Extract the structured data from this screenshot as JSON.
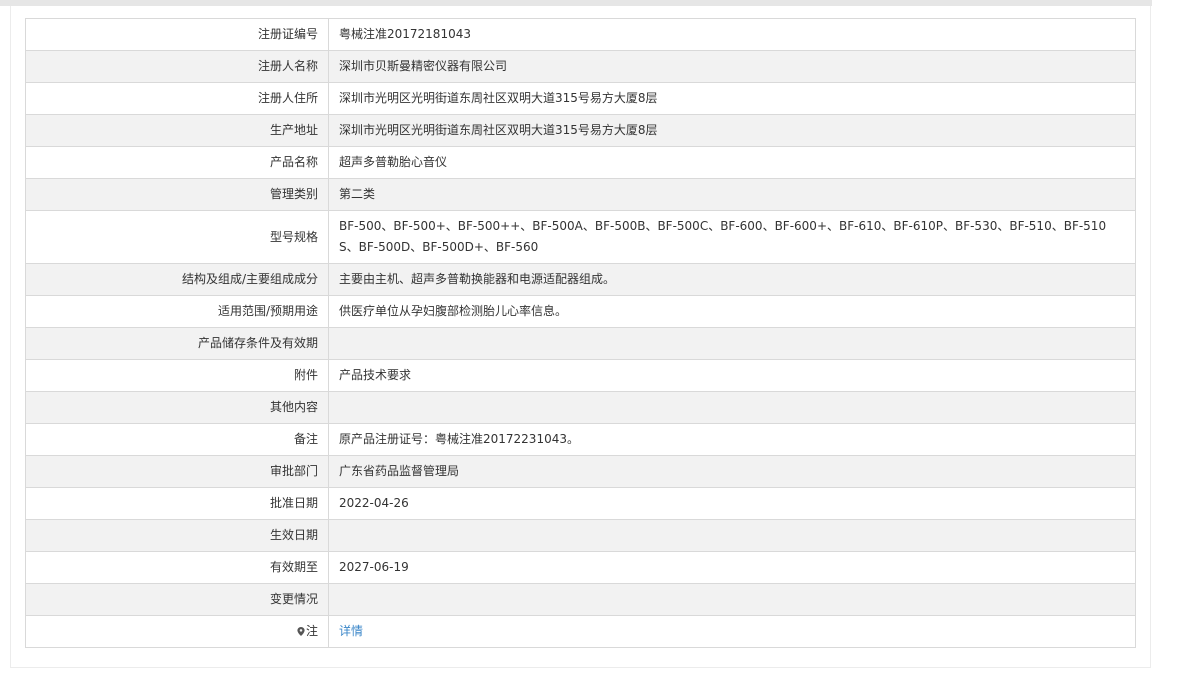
{
  "rows": [
    {
      "label": "注册证编号",
      "value": "粤械注准20172181043"
    },
    {
      "label": "注册人名称",
      "value": "深圳市贝斯曼精密仪器有限公司"
    },
    {
      "label": "注册人住所",
      "value": "深圳市光明区光明街道东周社区双明大道315号易方大厦8层"
    },
    {
      "label": "生产地址",
      "value": "深圳市光明区光明街道东周社区双明大道315号易方大厦8层"
    },
    {
      "label": "产品名称",
      "value": "超声多普勒胎心音仪"
    },
    {
      "label": "管理类别",
      "value": "第二类"
    },
    {
      "label": "型号规格",
      "value": "BF-500、BF-500+、BF-500++、BF-500A、BF-500B、BF-500C、BF-600、BF-600+、BF-610、BF-610P、BF-530、BF-510、BF-510S、BF-500D、BF-500D+、BF-560"
    },
    {
      "label": "结构及组成/主要组成成分",
      "value": "主要由主机、超声多普勒换能器和电源适配器组成。"
    },
    {
      "label": "适用范围/预期用途",
      "value": "供医疗单位从孕妇腹部检测胎儿心率信息。"
    },
    {
      "label": "产品储存条件及有效期",
      "value": ""
    },
    {
      "label": "附件",
      "value": "产品技术要求"
    },
    {
      "label": "其他内容",
      "value": ""
    },
    {
      "label": "备注",
      "value": "原产品注册证号：粤械注准20172231043。"
    },
    {
      "label": "审批部门",
      "value": "广东省药品监督管理局"
    },
    {
      "label": "批准日期",
      "value": "2022-04-26"
    },
    {
      "label": "生效日期",
      "value": ""
    },
    {
      "label": "有效期至",
      "value": "2027-06-19"
    },
    {
      "label": "变更情况",
      "value": ""
    }
  ],
  "note_row": {
    "label": "注",
    "icon": "location-pin-icon",
    "link_text": "详情"
  }
}
